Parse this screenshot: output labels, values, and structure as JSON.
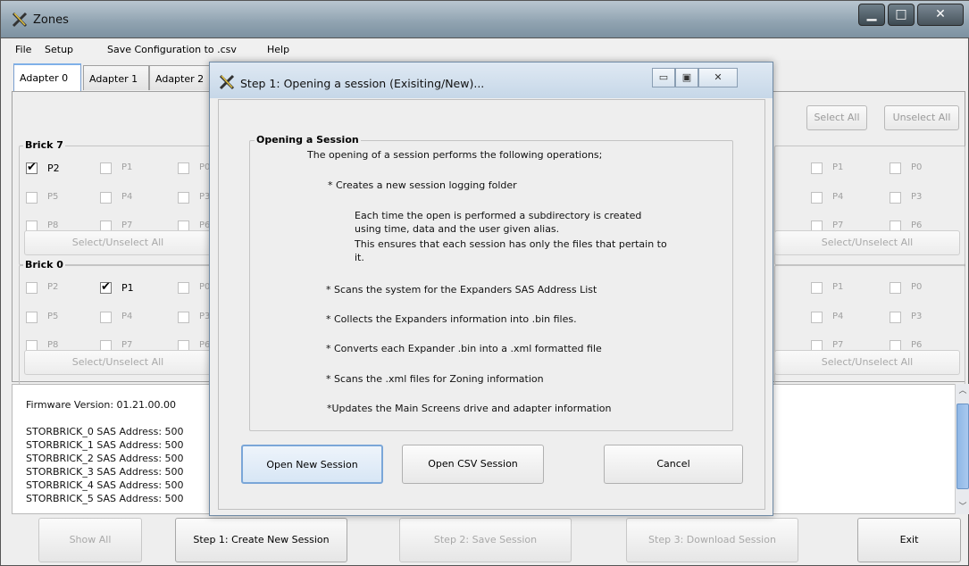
{
  "window": {
    "title": "Zones"
  },
  "menu": {
    "file": "File",
    "setup": "Setup",
    "save_csv": "Save Configuration to .csv",
    "help": "Help"
  },
  "tabs": [
    "Adapter 0",
    "Adapter 1",
    "Adapter 2"
  ],
  "toolbar": {
    "select_all": "Select All",
    "unselect_all": "Unselect All"
  },
  "bricks": [
    {
      "name": "Brick 7",
      "left_rows": [
        [
          {
            "label": "P2",
            "checked": true
          },
          {
            "label": "P1",
            "checked": false
          },
          {
            "label": "P0",
            "checked": false
          }
        ],
        [
          {
            "label": "P5",
            "checked": false
          },
          {
            "label": "P4",
            "checked": false
          },
          {
            "label": "P3",
            "checked": false
          }
        ],
        [
          {
            "label": "P8",
            "checked": false
          },
          {
            "label": "P7",
            "checked": false
          },
          {
            "label": "P6",
            "checked": false
          }
        ]
      ],
      "right_rows": [
        [
          {
            "label": "P1",
            "checked": false
          },
          {
            "label": "P0",
            "checked": false
          }
        ],
        [
          {
            "label": "P4",
            "checked": false
          },
          {
            "label": "P3",
            "checked": false
          }
        ],
        [
          {
            "label": "P7",
            "checked": false
          },
          {
            "label": "P6",
            "checked": false
          }
        ]
      ],
      "select_label": "Select/Unselect All"
    },
    {
      "name": "Brick 0",
      "left_rows": [
        [
          {
            "label": "P2",
            "checked": false
          },
          {
            "label": "P1",
            "checked": true
          },
          {
            "label": "P0",
            "checked": false
          }
        ],
        [
          {
            "label": "P5",
            "checked": false
          },
          {
            "label": "P4",
            "checked": false
          },
          {
            "label": "P3",
            "checked": false
          }
        ],
        [
          {
            "label": "P8",
            "checked": false
          },
          {
            "label": "P7",
            "checked": false
          },
          {
            "label": "P6",
            "checked": false
          }
        ]
      ],
      "right_rows": [
        [
          {
            "label": "P1",
            "checked": false
          },
          {
            "label": "P0",
            "checked": false
          }
        ],
        [
          {
            "label": "P4",
            "checked": false
          },
          {
            "label": "P3",
            "checked": false
          }
        ],
        [
          {
            "label": "P7",
            "checked": false
          },
          {
            "label": "P6",
            "checked": false
          }
        ]
      ],
      "select_label": "Select/Unselect All"
    }
  ],
  "log": {
    "firmware": "Firmware Version: 01.21.00.00",
    "lines": [
      "STORBRICK_0  SAS Address: 500",
      "STORBRICK_1  SAS Address: 500",
      "STORBRICK_2  SAS Address: 500",
      "STORBRICK_3  SAS Address: 500",
      "STORBRICK_4  SAS Address: 500",
      "STORBRICK_5  SAS Address: 500"
    ]
  },
  "bottom": {
    "show_all": "Show All",
    "step1": "Step 1: Create New Session",
    "step2": "Step 2: Save Session",
    "step3": "Step 3: Download Session",
    "exit": "Exit"
  },
  "dialog": {
    "title": "Step 1: Opening a session (Exisiting/New)...",
    "group_title": "Opening a Session",
    "intro": "The opening of a session performs the following operations;",
    "op1": "* Creates a new session logging folder",
    "op1_detail": [
      "Each time the open is performed a subdirectory is created",
      "using time, data and the user given alias.",
      "This ensures that each session has only the files that pertain to",
      " it."
    ],
    "op2": "* Scans the system for the Expanders SAS Address List",
    "op3": "* Collects the Expanders information into .bin files.",
    "op4": "* Converts each Expander .bin into a .xml formatted file",
    "op5": "* Scans the .xml files for Zoning information",
    "op6": "*Updates the Main Screens drive and adapter information",
    "buttons": {
      "open_new": "Open New Session",
      "open_csv": "Open CSV Session",
      "cancel": "Cancel"
    }
  }
}
